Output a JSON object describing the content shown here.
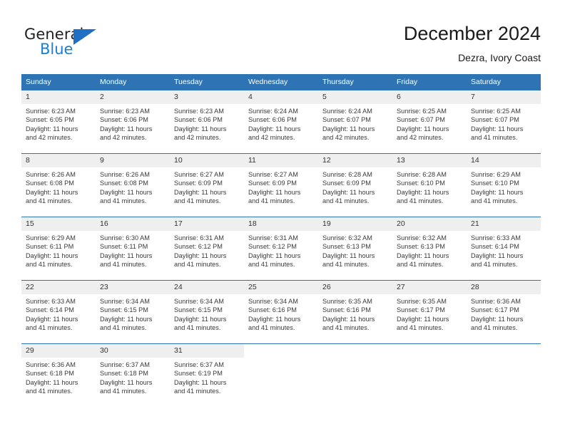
{
  "brand": {
    "name_top": "General",
    "name_bottom": "Blue",
    "triangle_color": "#1f6fc4",
    "blue_text_color": "#1a7fd4"
  },
  "header": {
    "title": "December 2024",
    "subtitle": "Dezra, Ivory Coast"
  },
  "theme": {
    "header_bg": "#2e74b5",
    "header_text": "#ffffff",
    "daynum_bg": "#efefef",
    "week_divider": "#2e74b5"
  },
  "weekdays": [
    "Sunday",
    "Monday",
    "Tuesday",
    "Wednesday",
    "Thursday",
    "Friday",
    "Saturday"
  ],
  "weeks": [
    [
      {
        "day": "1",
        "sunrise": "Sunrise: 6:23 AM",
        "sunset": "Sunset: 6:05 PM",
        "daylight1": "Daylight: 11 hours",
        "daylight2": "and 42 minutes."
      },
      {
        "day": "2",
        "sunrise": "Sunrise: 6:23 AM",
        "sunset": "Sunset: 6:06 PM",
        "daylight1": "Daylight: 11 hours",
        "daylight2": "and 42 minutes."
      },
      {
        "day": "3",
        "sunrise": "Sunrise: 6:23 AM",
        "sunset": "Sunset: 6:06 PM",
        "daylight1": "Daylight: 11 hours",
        "daylight2": "and 42 minutes."
      },
      {
        "day": "4",
        "sunrise": "Sunrise: 6:24 AM",
        "sunset": "Sunset: 6:06 PM",
        "daylight1": "Daylight: 11 hours",
        "daylight2": "and 42 minutes."
      },
      {
        "day": "5",
        "sunrise": "Sunrise: 6:24 AM",
        "sunset": "Sunset: 6:07 PM",
        "daylight1": "Daylight: 11 hours",
        "daylight2": "and 42 minutes."
      },
      {
        "day": "6",
        "sunrise": "Sunrise: 6:25 AM",
        "sunset": "Sunset: 6:07 PM",
        "daylight1": "Daylight: 11 hours",
        "daylight2": "and 42 minutes."
      },
      {
        "day": "7",
        "sunrise": "Sunrise: 6:25 AM",
        "sunset": "Sunset: 6:07 PM",
        "daylight1": "Daylight: 11 hours",
        "daylight2": "and 41 minutes."
      }
    ],
    [
      {
        "day": "8",
        "sunrise": "Sunrise: 6:26 AM",
        "sunset": "Sunset: 6:08 PM",
        "daylight1": "Daylight: 11 hours",
        "daylight2": "and 41 minutes."
      },
      {
        "day": "9",
        "sunrise": "Sunrise: 6:26 AM",
        "sunset": "Sunset: 6:08 PM",
        "daylight1": "Daylight: 11 hours",
        "daylight2": "and 41 minutes."
      },
      {
        "day": "10",
        "sunrise": "Sunrise: 6:27 AM",
        "sunset": "Sunset: 6:09 PM",
        "daylight1": "Daylight: 11 hours",
        "daylight2": "and 41 minutes."
      },
      {
        "day": "11",
        "sunrise": "Sunrise: 6:27 AM",
        "sunset": "Sunset: 6:09 PM",
        "daylight1": "Daylight: 11 hours",
        "daylight2": "and 41 minutes."
      },
      {
        "day": "12",
        "sunrise": "Sunrise: 6:28 AM",
        "sunset": "Sunset: 6:09 PM",
        "daylight1": "Daylight: 11 hours",
        "daylight2": "and 41 minutes."
      },
      {
        "day": "13",
        "sunrise": "Sunrise: 6:28 AM",
        "sunset": "Sunset: 6:10 PM",
        "daylight1": "Daylight: 11 hours",
        "daylight2": "and 41 minutes."
      },
      {
        "day": "14",
        "sunrise": "Sunrise: 6:29 AM",
        "sunset": "Sunset: 6:10 PM",
        "daylight1": "Daylight: 11 hours",
        "daylight2": "and 41 minutes."
      }
    ],
    [
      {
        "day": "15",
        "sunrise": "Sunrise: 6:29 AM",
        "sunset": "Sunset: 6:11 PM",
        "daylight1": "Daylight: 11 hours",
        "daylight2": "and 41 minutes."
      },
      {
        "day": "16",
        "sunrise": "Sunrise: 6:30 AM",
        "sunset": "Sunset: 6:11 PM",
        "daylight1": "Daylight: 11 hours",
        "daylight2": "and 41 minutes."
      },
      {
        "day": "17",
        "sunrise": "Sunrise: 6:31 AM",
        "sunset": "Sunset: 6:12 PM",
        "daylight1": "Daylight: 11 hours",
        "daylight2": "and 41 minutes."
      },
      {
        "day": "18",
        "sunrise": "Sunrise: 6:31 AM",
        "sunset": "Sunset: 6:12 PM",
        "daylight1": "Daylight: 11 hours",
        "daylight2": "and 41 minutes."
      },
      {
        "day": "19",
        "sunrise": "Sunrise: 6:32 AM",
        "sunset": "Sunset: 6:13 PM",
        "daylight1": "Daylight: 11 hours",
        "daylight2": "and 41 minutes."
      },
      {
        "day": "20",
        "sunrise": "Sunrise: 6:32 AM",
        "sunset": "Sunset: 6:13 PM",
        "daylight1": "Daylight: 11 hours",
        "daylight2": "and 41 minutes."
      },
      {
        "day": "21",
        "sunrise": "Sunrise: 6:33 AM",
        "sunset": "Sunset: 6:14 PM",
        "daylight1": "Daylight: 11 hours",
        "daylight2": "and 41 minutes."
      }
    ],
    [
      {
        "day": "22",
        "sunrise": "Sunrise: 6:33 AM",
        "sunset": "Sunset: 6:14 PM",
        "daylight1": "Daylight: 11 hours",
        "daylight2": "and 41 minutes."
      },
      {
        "day": "23",
        "sunrise": "Sunrise: 6:34 AM",
        "sunset": "Sunset: 6:15 PM",
        "daylight1": "Daylight: 11 hours",
        "daylight2": "and 41 minutes."
      },
      {
        "day": "24",
        "sunrise": "Sunrise: 6:34 AM",
        "sunset": "Sunset: 6:15 PM",
        "daylight1": "Daylight: 11 hours",
        "daylight2": "and 41 minutes."
      },
      {
        "day": "25",
        "sunrise": "Sunrise: 6:34 AM",
        "sunset": "Sunset: 6:16 PM",
        "daylight1": "Daylight: 11 hours",
        "daylight2": "and 41 minutes."
      },
      {
        "day": "26",
        "sunrise": "Sunrise: 6:35 AM",
        "sunset": "Sunset: 6:16 PM",
        "daylight1": "Daylight: 11 hours",
        "daylight2": "and 41 minutes."
      },
      {
        "day": "27",
        "sunrise": "Sunrise: 6:35 AM",
        "sunset": "Sunset: 6:17 PM",
        "daylight1": "Daylight: 11 hours",
        "daylight2": "and 41 minutes."
      },
      {
        "day": "28",
        "sunrise": "Sunrise: 6:36 AM",
        "sunset": "Sunset: 6:17 PM",
        "daylight1": "Daylight: 11 hours",
        "daylight2": "and 41 minutes."
      }
    ],
    [
      {
        "day": "29",
        "sunrise": "Sunrise: 6:36 AM",
        "sunset": "Sunset: 6:18 PM",
        "daylight1": "Daylight: 11 hours",
        "daylight2": "and 41 minutes."
      },
      {
        "day": "30",
        "sunrise": "Sunrise: 6:37 AM",
        "sunset": "Sunset: 6:18 PM",
        "daylight1": "Daylight: 11 hours",
        "daylight2": "and 41 minutes."
      },
      {
        "day": "31",
        "sunrise": "Sunrise: 6:37 AM",
        "sunset": "Sunset: 6:19 PM",
        "daylight1": "Daylight: 11 hours",
        "daylight2": "and 41 minutes."
      },
      {
        "day": "",
        "sunrise": "",
        "sunset": "",
        "daylight1": "",
        "daylight2": ""
      },
      {
        "day": "",
        "sunrise": "",
        "sunset": "",
        "daylight1": "",
        "daylight2": ""
      },
      {
        "day": "",
        "sunrise": "",
        "sunset": "",
        "daylight1": "",
        "daylight2": ""
      },
      {
        "day": "",
        "sunrise": "",
        "sunset": "",
        "daylight1": "",
        "daylight2": ""
      }
    ]
  ]
}
